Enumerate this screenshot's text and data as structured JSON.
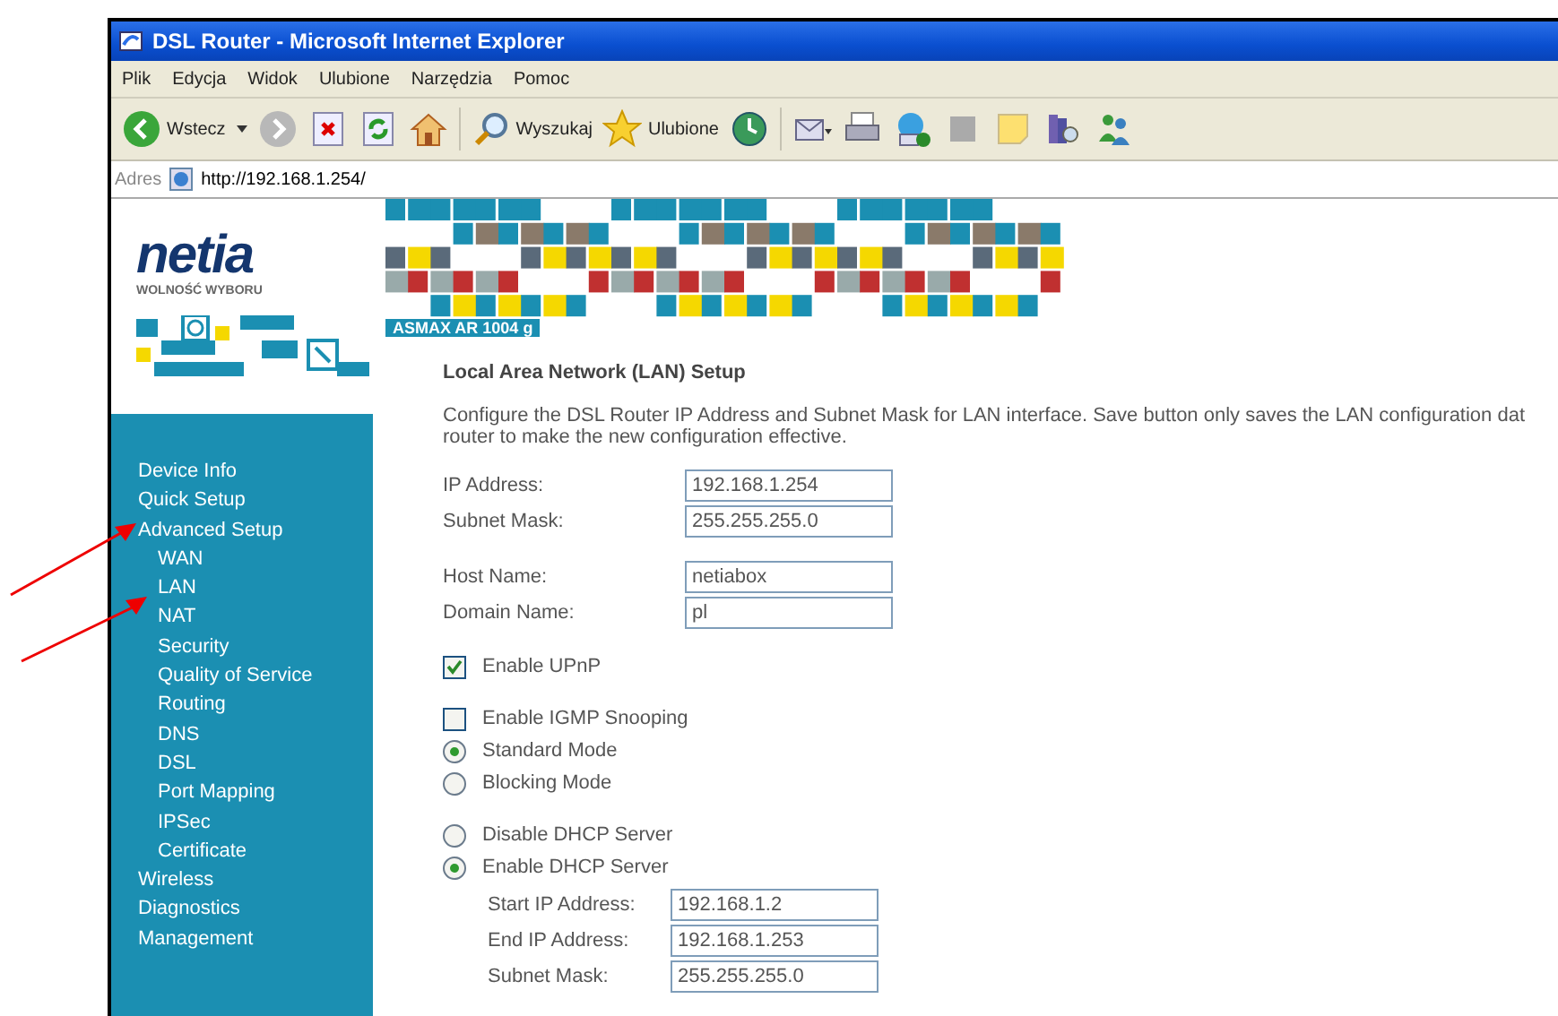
{
  "window": {
    "title": "DSL Router - Microsoft Internet Explorer"
  },
  "menu": [
    "Plik",
    "Edycja",
    "Widok",
    "Ulubione",
    "Narzędzia",
    "Pomoc"
  ],
  "toolbar": {
    "back": "Wstecz",
    "search": "Wyszukaj",
    "favorites": "Ulubione"
  },
  "address": {
    "label": "Adres",
    "value": "http://192.168.1.254/"
  },
  "logo": {
    "name": "netia",
    "tagline": "WOLNOŚĆ WYBORU"
  },
  "banner": {
    "model": "ASMAX AR 1004 g"
  },
  "sidebar": {
    "items": [
      {
        "label": "Device Info"
      },
      {
        "label": "Quick Setup"
      },
      {
        "label": "Advanced Setup",
        "children": [
          {
            "label": "WAN"
          },
          {
            "label": "LAN"
          },
          {
            "label": "NAT"
          },
          {
            "label": "Security"
          },
          {
            "label": "Quality of Service"
          },
          {
            "label": "Routing"
          },
          {
            "label": "DNS"
          },
          {
            "label": "DSL"
          },
          {
            "label": "Port Mapping"
          },
          {
            "label": "IPSec"
          },
          {
            "label": "Certificate"
          }
        ]
      },
      {
        "label": "Wireless"
      },
      {
        "label": "Diagnostics"
      },
      {
        "label": "Management"
      }
    ]
  },
  "page": {
    "title": "Local Area Network (LAN) Setup",
    "description": [
      "Configure the DSL Router IP Address and Subnet Mask for LAN interface.  Save button only saves the LAN configuration dat",
      "router to make the new configuration effective."
    ],
    "sections": [
      {
        "items": [
          {
            "kind": "field",
            "label": "IP Address:",
            "value": "192.168.1.254"
          },
          {
            "kind": "field",
            "label": "Subnet Mask:",
            "value": "255.255.255.0"
          }
        ]
      },
      {
        "items": [
          {
            "kind": "field",
            "label": "Host Name:",
            "value": "netiabox"
          },
          {
            "kind": "field",
            "label": "Domain Name:",
            "value": "pl"
          }
        ]
      },
      {
        "items": [
          {
            "kind": "checkbox",
            "label": "Enable UPnP",
            "checked": true
          }
        ]
      },
      {
        "items": [
          {
            "kind": "checkbox",
            "label": "Enable IGMP Snooping",
            "checked": false
          },
          {
            "kind": "radio",
            "label": "Standard Mode",
            "selected": true
          },
          {
            "kind": "radio",
            "label": "Blocking Mode",
            "selected": false
          }
        ]
      },
      {
        "items": [
          {
            "kind": "radio",
            "label": "Disable DHCP Server",
            "selected": false
          },
          {
            "kind": "radio",
            "label": "Enable DHCP Server",
            "selected": true,
            "fields": [
              {
                "label": "Start IP Address:",
                "value": "192.168.1.2"
              },
              {
                "label": "End IP Address:",
                "value": "192.168.1.253"
              },
              {
                "label": "Subnet Mask:",
                "value": "255.255.255.0"
              }
            ]
          }
        ]
      }
    ]
  }
}
